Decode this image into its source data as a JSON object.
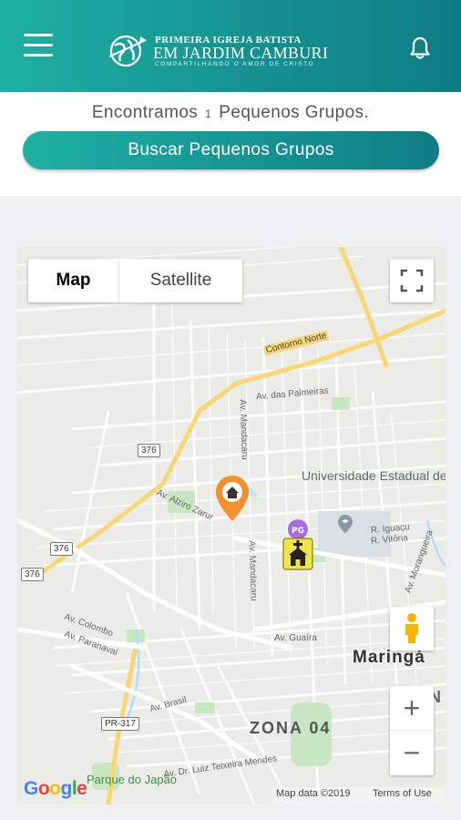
{
  "header": {
    "logo_line1": "PRIMEIRA IGREJA BATISTA",
    "logo_line2": "EM JARDIM CAMBURI",
    "logo_line3": "COMPARTILHANDO O AMOR DE CRISTO",
    "menu_icon": "hamburger-menu-icon",
    "bell_icon": "bell-icon"
  },
  "summary": {
    "found_prefix": "Encontramos",
    "found_count": "1",
    "found_suffix": "Pequenos Grupos.",
    "search_button": "Buscar Pequenos Grupos"
  },
  "map": {
    "type_map": "Map",
    "type_satellite": "Satellite",
    "zoom_in": "+",
    "zoom_out": "−",
    "roads": {
      "contorno_norte": "Contorno Norte",
      "av_palmeiras": "Av. das Palmeiras",
      "av_mandacaru_n": "Av. Mandacaru",
      "av_mandacaru_s": "Av. Mandacaru",
      "av_alziro": "Av. Alziro Zarur",
      "av_colombo": "Av. Colombo",
      "av_paranavai": "Av. Paranavaí",
      "av_guaira": "Av. Guaíra",
      "av_brasil": "Av. Brasil",
      "av_luiz": "Av. Dr. Luiz Teixeira Mendes",
      "av_iguacu": "R. Iguaçu",
      "av_vitoria": "R. Vitória",
      "av_morangueira": "Av. Morangueira"
    },
    "shields": [
      "376",
      "376",
      "376",
      "PR-317"
    ],
    "places": {
      "university": "Universidade Estadual de Maringá",
      "city": "Maringá",
      "zone": "ZONA 04",
      "park": "Parque do Japão",
      "edge_letter": "N"
    },
    "attribution": {
      "google": [
        "G",
        "o",
        "o",
        "g",
        "l",
        "e"
      ],
      "map_data": "Map data ©2019",
      "terms": "Terms of Use"
    },
    "marker_icons": [
      "home-pin-icon",
      "church-marker-icon"
    ],
    "colors": {
      "water": "#aadaff",
      "park": "#c8e6c1",
      "highway": "#f7d774",
      "home_pin": "#f2902b",
      "church_marker": "#f3e34a"
    }
  }
}
